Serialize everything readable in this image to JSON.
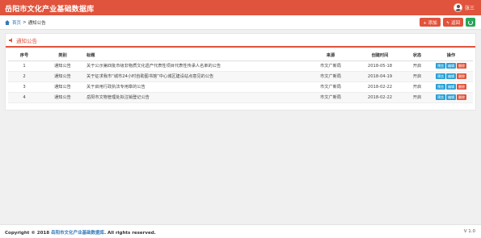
{
  "app": {
    "title": "岳阳市文化产业基础数据库",
    "user_name": "张三"
  },
  "breadcrumb": {
    "home": "首页",
    "separator": ">",
    "current": "通知公告"
  },
  "toolbar": {
    "add_label": "+ 添加",
    "back_label": "↰ 返回"
  },
  "panel": {
    "title": "通知公告"
  },
  "table": {
    "headers": {
      "index": "序号",
      "category": "类别",
      "title": "标题",
      "source": "来源",
      "created": "创建时间",
      "status": "状态",
      "actions": "操作"
    },
    "rows": [
      {
        "index": "1",
        "category": "通知公告",
        "title": "关于公示第四批市级非物质文化遗产代表性项目代表性传承人名单的公告",
        "source": "市文广新局",
        "created": "2018-05-18",
        "status": "开启"
      },
      {
        "index": "2",
        "category": "通知公告",
        "title": "关于征求我市“城市24小时自助图书馆”中心城区建设站点意见的公告",
        "source": "市文广新局",
        "created": "2018-04-19",
        "status": "开启"
      },
      {
        "index": "3",
        "category": "通知公告",
        "title": "关于启用行政执法专用章的公告",
        "source": "市文广新局",
        "created": "2018-02-22",
        "status": "开启"
      },
      {
        "index": "4",
        "category": "通知公告",
        "title": "岳阳市文物管理处拟注销登记公告",
        "source": "市文广新局",
        "created": "2018-02-22",
        "status": "开启"
      }
    ],
    "action_labels": {
      "view": "预览",
      "edit": "编辑",
      "delete": "删除"
    }
  },
  "footer": {
    "copyright_prefix": "Copyright © 2018",
    "copyright_link": "岳阳市文化产业基础数据库",
    "copyright_suffix": ". All rights reserved.",
    "version": "V 1.0"
  },
  "colors": {
    "brand": "#e0533c",
    "info": "#2a9fd6",
    "success": "#2aa55a"
  }
}
